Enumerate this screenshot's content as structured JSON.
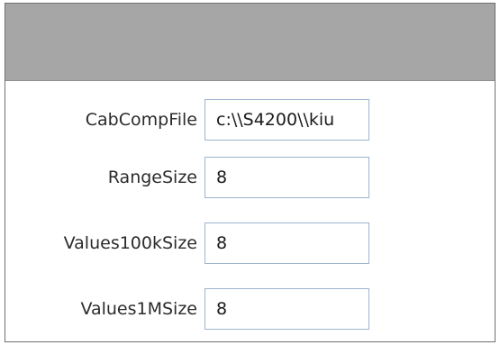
{
  "fields": [
    {
      "label": "CabCompFile",
      "value": "c:\\\\S4200\\\\kiu"
    },
    {
      "label": "RangeSize",
      "value": "8"
    },
    {
      "label": "Values100kSize",
      "value": "8"
    },
    {
      "label": "Values1MSize",
      "value": "8"
    }
  ],
  "colors": {
    "header_bar": "#a6a6a6",
    "input_border": "#9fb4cf",
    "panel_border": "#707070"
  }
}
